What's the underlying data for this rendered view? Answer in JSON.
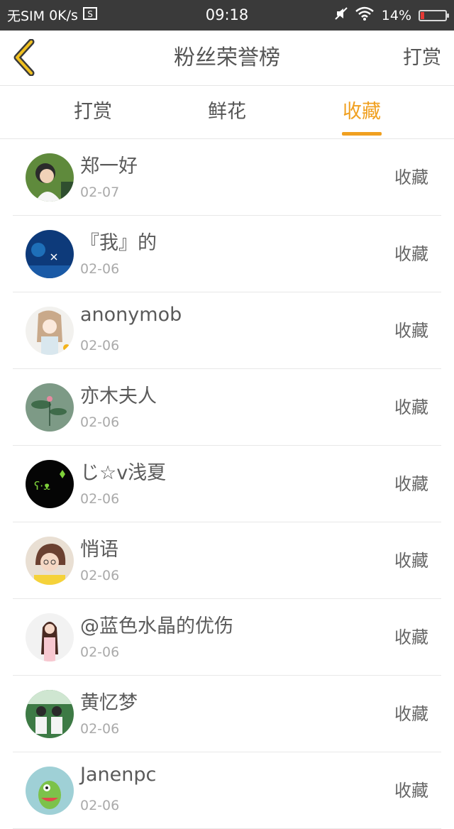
{
  "status_bar": {
    "sim": "无SIM",
    "speed": "0K/s",
    "time": "09:18",
    "battery": "14%",
    "battery_level": 0.14
  },
  "header": {
    "title": "粉丝荣誉榜",
    "action": "打赏"
  },
  "tabs": [
    {
      "label": "打赏",
      "active": false
    },
    {
      "label": "鲜花",
      "active": false
    },
    {
      "label": "收藏",
      "active": true
    }
  ],
  "rows": [
    {
      "name": "郑一好",
      "date": "02-07",
      "action": "收藏"
    },
    {
      "name": "『我』的",
      "date": "02-06",
      "action": "收藏"
    },
    {
      "name": "anonymob",
      "date": "02-06",
      "action": "收藏"
    },
    {
      "name": "亦木夫人",
      "date": "02-06",
      "action": "收藏"
    },
    {
      "name": "じ☆v浅夏",
      "date": "02-06",
      "action": "收藏"
    },
    {
      "name": "悄语",
      "date": "02-06",
      "action": "收藏"
    },
    {
      "name": "@蓝色水晶的优伤",
      "date": "02-06",
      "action": "收藏"
    },
    {
      "name": "黄忆梦",
      "date": "02-06",
      "action": "收藏"
    },
    {
      "name": "Janenpc",
      "date": "02-06",
      "action": "收藏"
    }
  ],
  "colors": {
    "accent": "#f0a020",
    "status_bar": "#3a3a3a",
    "text": "#5a5a5a",
    "muted": "#aaaaaa"
  }
}
